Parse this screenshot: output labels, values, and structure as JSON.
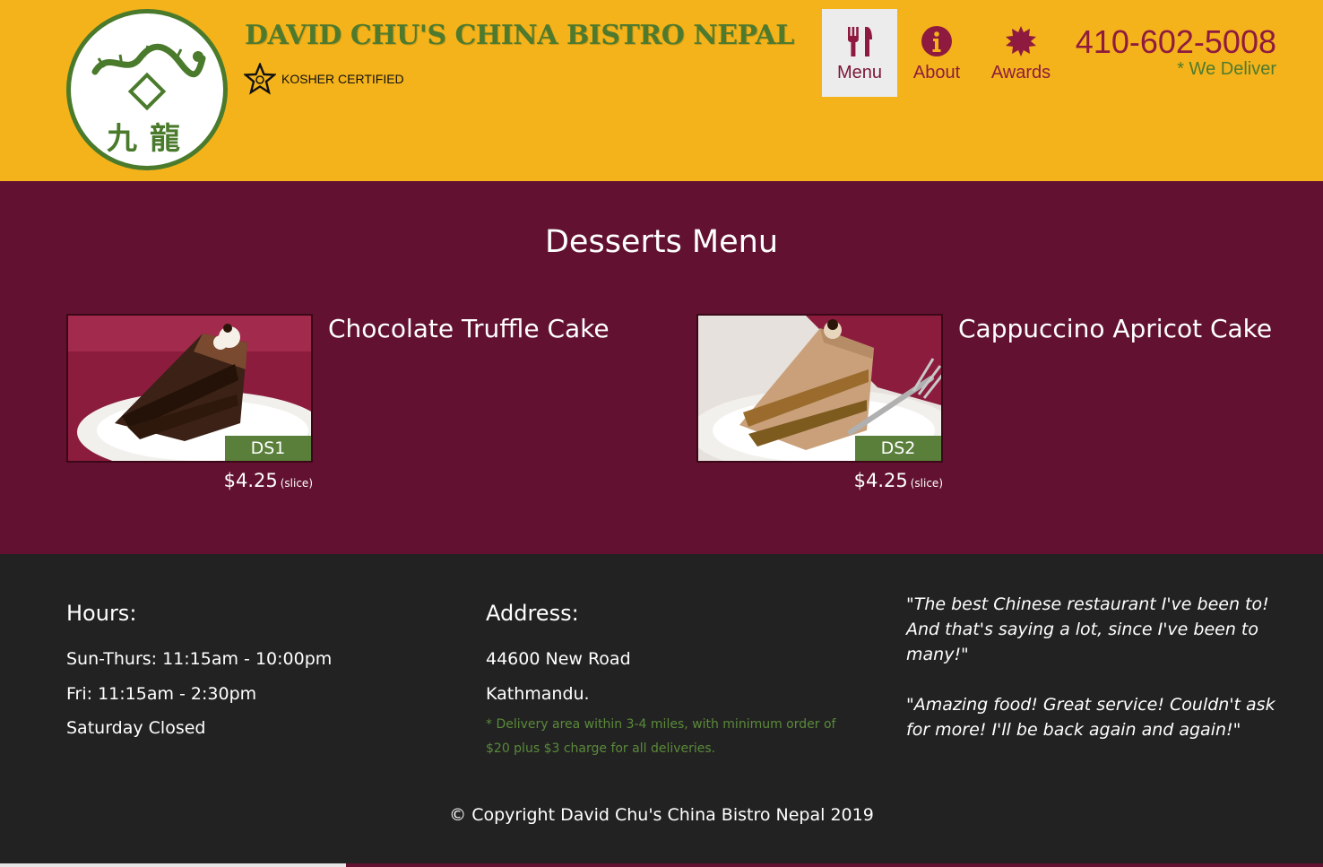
{
  "header": {
    "brand": "DAVID CHU'S CHINA BISTRO NEPAL",
    "logo_chars": "九龍",
    "kosher": "KOSHER CERTIFIED",
    "phone": "410-602-5008",
    "deliver": "* We Deliver"
  },
  "nav": [
    {
      "label": "Menu",
      "icon": "fork-knife-icon",
      "active": true
    },
    {
      "label": "About",
      "icon": "info-icon",
      "active": false
    },
    {
      "label": "Awards",
      "icon": "award-icon",
      "active": false
    }
  ],
  "main": {
    "title": "Desserts Menu",
    "items": [
      {
        "name": "Chocolate Truffle Cake",
        "code": "DS1",
        "price": "$4.25",
        "unit": "(slice)"
      },
      {
        "name": "Cappuccino Apricot Cake",
        "code": "DS2",
        "price": "$4.25",
        "unit": "(slice)"
      }
    ]
  },
  "footer": {
    "hours": {
      "heading": "Hours:",
      "lines": [
        "Sun-Thurs: 11:15am - 10:00pm",
        "Fri: 11:15am - 2:30pm",
        "Saturday Closed"
      ]
    },
    "address": {
      "heading": "Address:",
      "lines": [
        "44600 New Road",
        "Kathmandu."
      ],
      "note": "* Delivery area within 3-4 miles, with minimum order of $20 plus $3 charge for all deliveries."
    },
    "quotes": [
      "\"The best Chinese restaurant I've been to! And that's saying a lot, since I've been to many!\"",
      "\"Amazing food! Great service! Couldn't ask for more! I'll be back again and again!\""
    ],
    "copyright": "© Copyright David Chu's China Bistro Nepal 2019"
  },
  "colors": {
    "header_bg": "#f4b31a",
    "main_bg": "#621230",
    "footer_bg": "#222222",
    "accent": "#8e1b3f",
    "brand_green": "#4f7a2e"
  }
}
